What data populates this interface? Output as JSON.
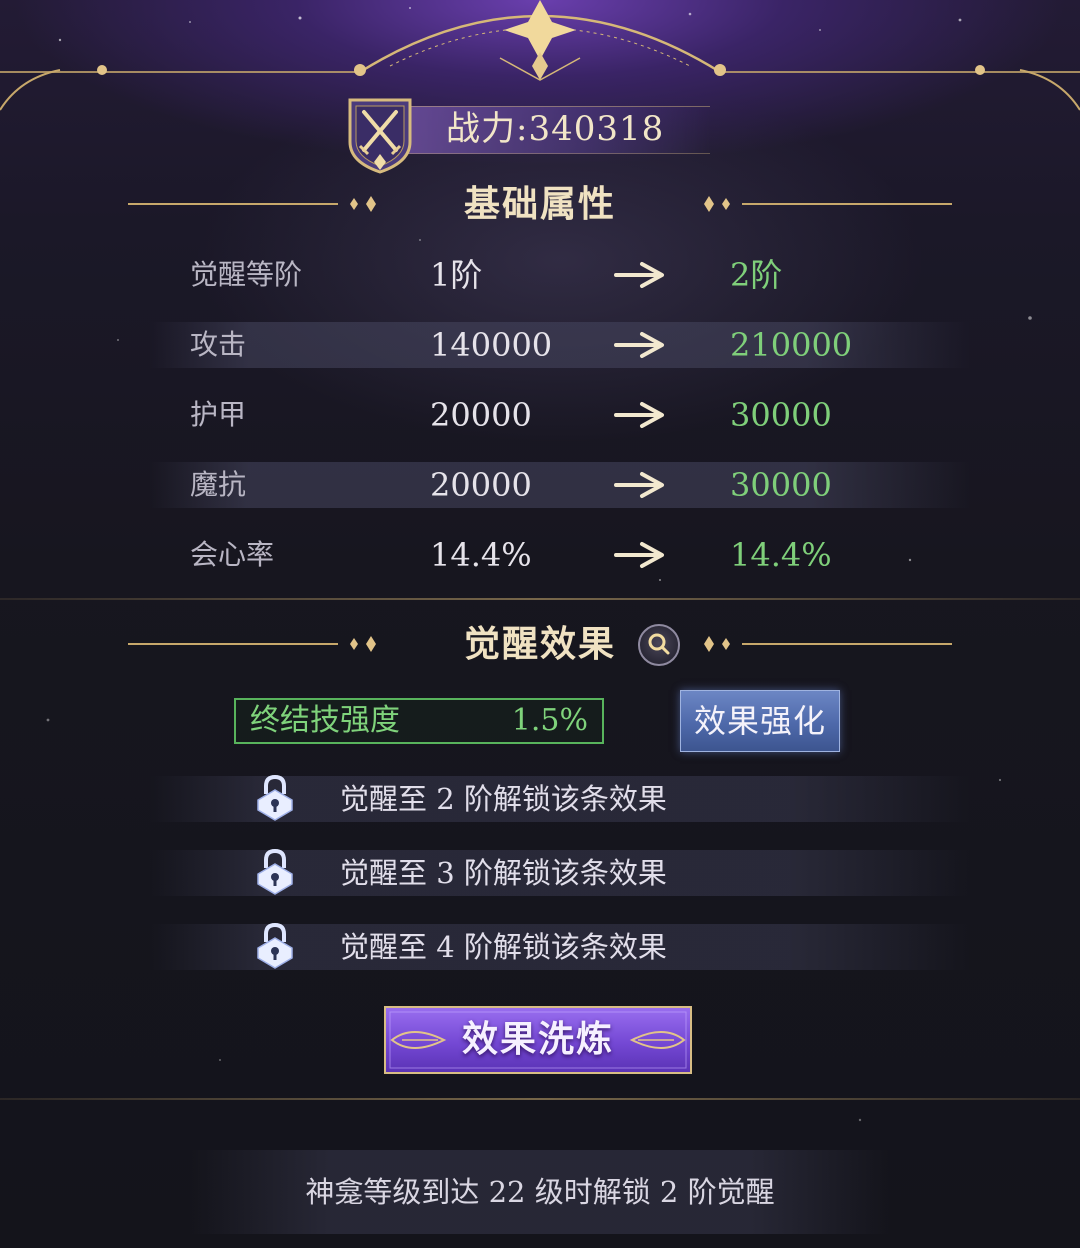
{
  "power": {
    "label": "战力:340318"
  },
  "basic_section": {
    "title": "基础属性",
    "rows": [
      {
        "name": "觉醒等阶",
        "current": "1阶",
        "next": "2阶"
      },
      {
        "name": "攻击",
        "current": "140000",
        "next": "210000"
      },
      {
        "name": "护甲",
        "current": "20000",
        "next": "30000"
      },
      {
        "name": "魔抗",
        "current": "20000",
        "next": "30000"
      },
      {
        "name": "会心率",
        "current": "14.4%",
        "next": "14.4%"
      }
    ]
  },
  "effect_section": {
    "title": "觉醒效果",
    "effect": {
      "name": "终结技强度",
      "value": "1.5%"
    },
    "enhance_label": "效果强化",
    "locked": [
      {
        "text": "觉醒至 2 阶解锁该条效果"
      },
      {
        "text": "觉醒至 3 阶解锁该条效果"
      },
      {
        "text": "觉醒至 4 阶解锁该条效果"
      }
    ],
    "refine_label": "效果洗炼"
  },
  "footer": {
    "text": "神龛等级到达 22 级时解锁 2 阶觉醒"
  },
  "colors": {
    "gold": "#d8bd84",
    "green_value": "#7fcf7a",
    "enhance_button": "#5a75b4",
    "refine_button": "#7b4fd0"
  },
  "icons": {
    "emblem": "crossed-swords-shield-icon",
    "arrow": "arrow-right-icon",
    "search": "magnifier-icon",
    "lock": "lock-icon"
  }
}
